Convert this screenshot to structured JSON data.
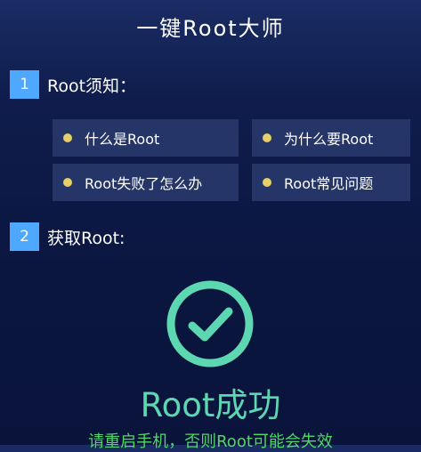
{
  "header": {
    "title": "一键Root大师"
  },
  "sections": [
    {
      "number": "1",
      "title": "Root须知："
    },
    {
      "number": "2",
      "title": "获取Root:"
    }
  ],
  "topics": [
    {
      "label": "什么是Root"
    },
    {
      "label": "为什么要Root"
    },
    {
      "label": "Root失败了怎么办"
    },
    {
      "label": "Root常见问题"
    }
  ],
  "result": {
    "icon": "check-circle-icon",
    "title": "Root成功",
    "hint": "请重启手机，否则Root可能会失效"
  },
  "colors": {
    "background": "#0f1d4d",
    "badge": "#4fa8ff",
    "card": "#253567",
    "bullet": "#e8cf67",
    "success": "#5dd7b2",
    "hint": "#52d56b"
  }
}
